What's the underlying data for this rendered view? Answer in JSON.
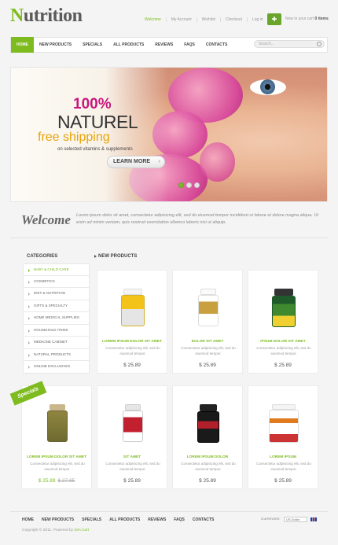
{
  "brand": {
    "logo_first": "N",
    "logo_rest": "utrition",
    "accent": "#7dbb1e"
  },
  "toplinks": [
    "Welcome",
    "My Account",
    "Wishlist",
    "Checkout",
    "Log in"
  ],
  "cart": {
    "icon": "cart-icon",
    "text": "Now in your cart",
    "count": "0 items"
  },
  "nav": [
    "HOME",
    "NEW PRODUCTS",
    "SPECIALS",
    "ALL PRODUCTS",
    "REVIEWS",
    "FAQS",
    "CONTACTS"
  ],
  "search": {
    "placeholder": "Search..."
  },
  "banner": {
    "line1": "100%",
    "line2": "NATUREL",
    "line3": "free shipping",
    "line4": "on selected vitamins & supplements",
    "button": "LEARN MORE"
  },
  "welcome": {
    "title": "Welcome",
    "text": "Lorem ipsum dolor sit amet, consectetur adipisicing elit, sed do eiusmod tempor incididunt ut labore et dolore magna aliqua. Ut enim ad minim veniam, quis nostrud exercitation ullamco laboris nisi ut aliquip."
  },
  "categories": {
    "title": "CATEGORIES",
    "items": [
      "BABY & CHILD CARE",
      "COSMETICS",
      "DIET & NUTRITION",
      "GIFTS & SPECIALTY",
      "HOME MEDICAL SUPPLIES",
      "HOUSEHOLD ITEMS",
      "MEDICINE CABINET",
      "NATURAL PRODUCTS",
      "ONLINE EXCLUSIVES"
    ]
  },
  "specials_badge": "Specials",
  "new_products": {
    "title": "NEW PRODUCTS",
    "products": [
      {
        "name": "LOREM IPSUM DOLOR SIT AMET",
        "desc": "Consectetur adipisicing elit, sed do eiusmod tempor.",
        "price": "$ 25.89",
        "old_price": ""
      },
      {
        "name": "DOLOR SIT AMET",
        "desc": "Consectetur adipisicing elit, sed do eiusmod tempor.",
        "price": "$ 25.89",
        "old_price": ""
      },
      {
        "name": "IPSUM DOLOR SIT AMET",
        "desc": "Consectetur adipisicing elit, sed do eiusmod tempor.",
        "price": "$ 25.89",
        "old_price": ""
      },
      {
        "name": "LOREM IPSUM DOLOR SIT AMET",
        "desc": "Consectetur adipisicing elit, sed do eiusmod tempor.",
        "price": "$ 25.89",
        "old_price": "$ 27.85"
      },
      {
        "name": "SIT AMET",
        "desc": "Consectetur adipisicing elit, sed do eiusmod tempor.",
        "price": "$ 25.89",
        "old_price": ""
      },
      {
        "name": "LOREM IPSUM DOLOR",
        "desc": "Consectetur adipisicing elit, sed do eiusmod tempor.",
        "price": "$ 25.89",
        "old_price": ""
      },
      {
        "name": "LOREM IPSUM",
        "desc": "Consectetur adipisicing elit, sed do eiusmod tempor.",
        "price": "$ 25.89",
        "old_price": ""
      }
    ]
  },
  "footer": {
    "nav": [
      "HOME",
      "NEW PRODUCTS",
      "SPECIALS",
      "ALL PRODUCTS",
      "REVIEWS",
      "FAQS",
      "CONTACTS"
    ],
    "currency_label": "Currencies:",
    "currency_value": "US Dollar",
    "copyright_prefix": "Copyright © 2011. Powered by",
    "copyright_link": "Zen Cart"
  }
}
